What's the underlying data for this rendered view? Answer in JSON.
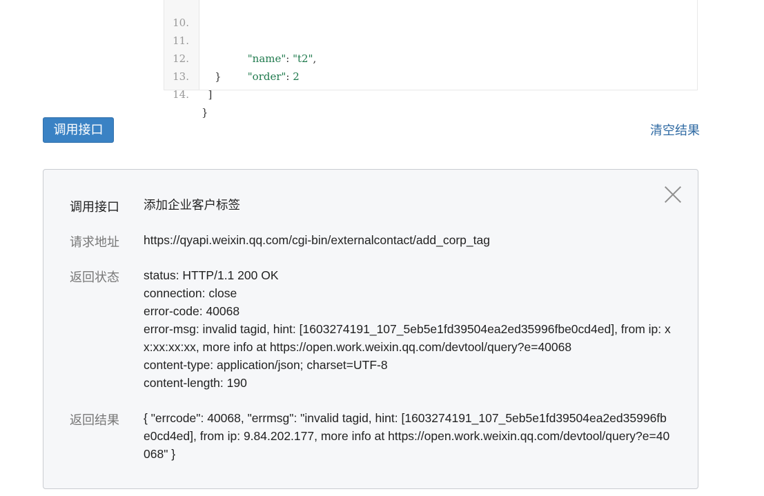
{
  "code": {
    "lines": [
      {
        "num": "10.",
        "indent": "        ",
        "key": "\"name\"",
        "sep": ": ",
        "val": "\"t2\"",
        "tail": ","
      },
      {
        "num": "11.",
        "indent": "        ",
        "key": "\"order\"",
        "sep": ": ",
        "val": "2",
        "tail": ""
      },
      {
        "num": "12.",
        "indent": "    ",
        "key": "",
        "sep": "",
        "val": "",
        "tail": "}"
      },
      {
        "num": "13.",
        "indent": "  ",
        "key": "",
        "sep": "",
        "val": "",
        "tail": "]"
      },
      {
        "num": "14.",
        "indent": "",
        "key": "",
        "sep": "",
        "val": "",
        "tail": "}"
      }
    ]
  },
  "actions": {
    "call_label": "调用接口",
    "clear_label": "清空结果"
  },
  "result": {
    "api_label": "调用接口",
    "api_value": "添加企业客户标签",
    "url_label": "请求地址",
    "url_value": "https://qyapi.weixin.qq.com/cgi-bin/externalcontact/add_corp_tag",
    "status_label": "返回状态",
    "status_lines": [
      "status: HTTP/1.1 200 OK",
      "connection: close",
      "error-code: 40068",
      "error-msg: invalid tagid, hint: [1603274191_107_5eb5e1fd39504ea2ed35996fbe0cd4ed], from ip: x",
      "x:xx:xx:xx, more info at https://open.work.weixin.qq.com/devtool/query?e=40068",
      "content-type: application/json; charset=UTF-8",
      "content-length: 190"
    ],
    "body_label": "返回结果",
    "body_lines": [
      "{ \"errcode\": 40068, \"errmsg\": \"invalid tagid, hint: [1603274191_107_5eb5e1fd39504ea2ed35996fb",
      "e0cd4ed], from ip: 9.84.202.177, more info at https://open.work.weixin.qq.com/devtool/query?e=40",
      "068\" }"
    ]
  }
}
